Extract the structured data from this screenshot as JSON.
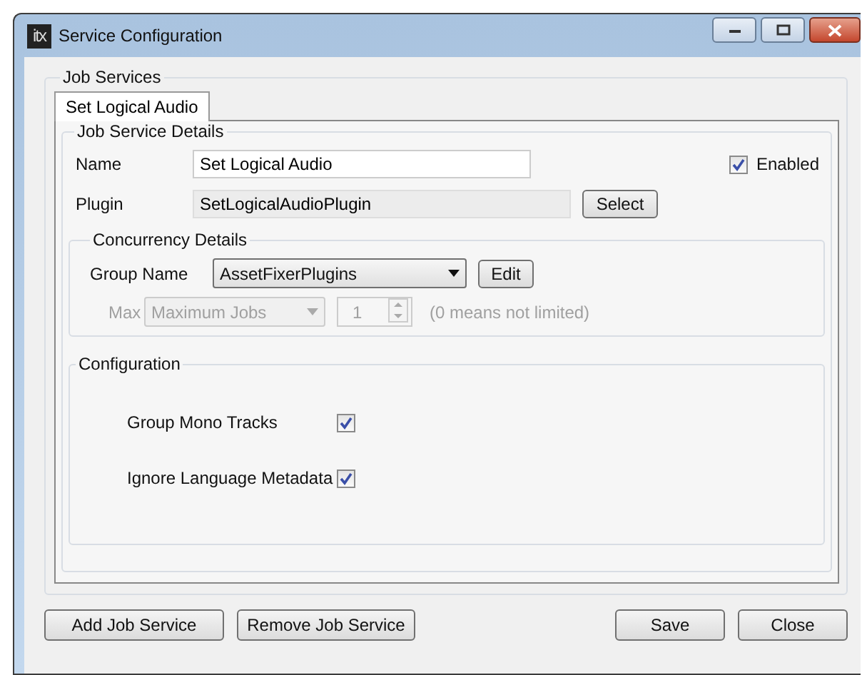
{
  "window": {
    "title": "Service Configuration",
    "logo": "itx"
  },
  "job_services": {
    "title": "Job Services",
    "tabs": [
      {
        "label": "Set Logical Audio",
        "selected": true
      }
    ]
  },
  "details": {
    "title": "Job Service Details",
    "name_label": "Name",
    "name_value": "Set Logical Audio",
    "enabled": {
      "label": "Enabled",
      "checked": true
    },
    "plugin_label": "Plugin",
    "plugin_value": "SetLogicalAudioPlugin",
    "select_button": "Select"
  },
  "concurrency": {
    "title": "Concurrency Details",
    "group_label": "Group Name",
    "group_value": "AssetFixerPlugins",
    "edit_button": "Edit",
    "max_label": "Max",
    "max_mode": "Maximum Jobs",
    "max_value": "1",
    "max_hint": "(0 means not limited)",
    "max_disabled": true
  },
  "configuration": {
    "title": "Configuration",
    "options": [
      {
        "label": "Group Mono Tracks",
        "checked": true
      },
      {
        "label": "Ignore Language Metadata",
        "checked": true
      }
    ]
  },
  "buttons_left": [
    "Add Job Service",
    "Remove Job Service"
  ],
  "buttons_right": [
    "Save",
    "Close"
  ]
}
